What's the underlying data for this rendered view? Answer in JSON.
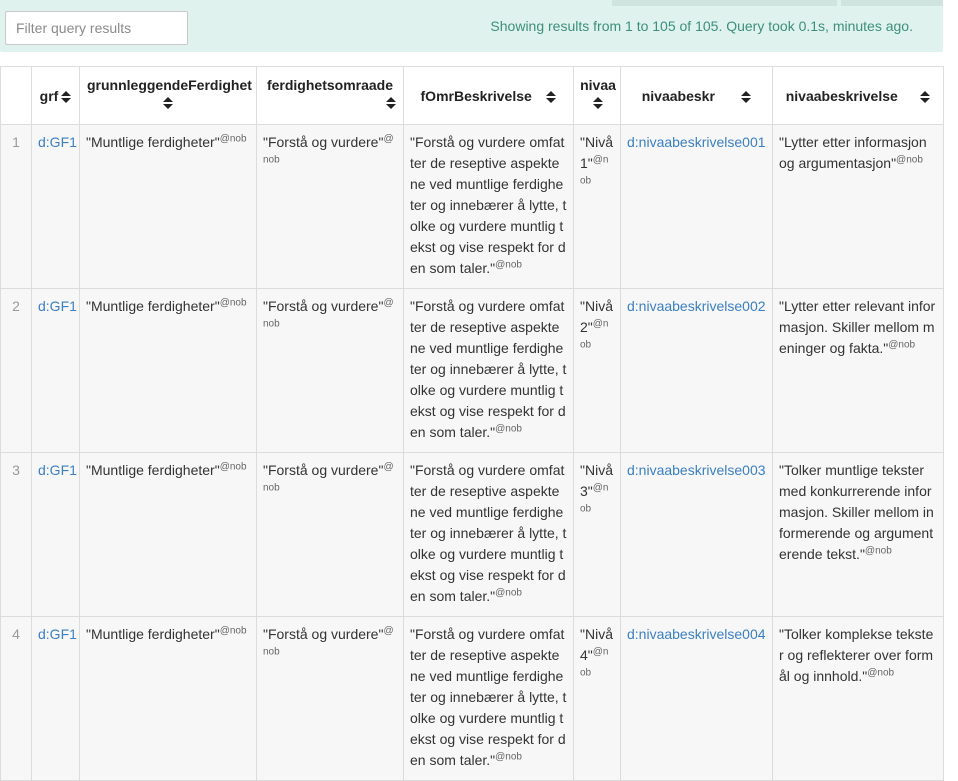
{
  "filter": {
    "placeholder": "Filter query results"
  },
  "status_text": "Showing results from 1 to 105 of 105. Query took 0.1s, minutes ago.",
  "columns": [
    "grf",
    "grunnleggendeFerdighet",
    "ferdighetsomraade",
    "fOmrBeskrivelse",
    "nivaa",
    "nivaabeskr",
    "nivaabeskrivelse"
  ],
  "rows": [
    {
      "num": "1",
      "grf": "d:GF1",
      "ferdighet": "\"Muntlige ferdigheter\"",
      "ferdighet_lang": "@nob",
      "omraade": "\"Forstå og vurdere\"",
      "omraade_lang": "@nob",
      "beskrivelse": "\"Forstå og vurdere omfatter de reseptive aspektene ved muntlige ferdigheter og innebærer å lytte, tolke og vurdere muntlig tekst og vise respekt for den som taler.\"",
      "beskrivelse_lang": "@nob",
      "nivaa": "\"Nivå 1\"",
      "nivaa_lang": "@nob",
      "nivaabeskr": "d:nivaabeskrivelse001",
      "nivaabeskrivelse": "\"Lytter etter informasjon og argumentasjon\"",
      "nivaabeskrivelse_lang": "@nob"
    },
    {
      "num": "2",
      "grf": "d:GF1",
      "ferdighet": "\"Muntlige ferdigheter\"",
      "ferdighet_lang": "@nob",
      "omraade": "\"Forstå og vurdere\"",
      "omraade_lang": "@nob",
      "beskrivelse": "\"Forstå og vurdere omfatter de reseptive aspektene ved muntlige ferdigheter og innebærer å lytte, tolke og vurdere muntlig tekst og vise respekt for den som taler.\"",
      "beskrivelse_lang": "@nob",
      "nivaa": "\"Nivå 2\"",
      "nivaa_lang": "@nob",
      "nivaabeskr": "d:nivaabeskrivelse002",
      "nivaabeskrivelse": "\"Lytter etter relevant informasjon. Skiller mellom meninger og fakta.\"",
      "nivaabeskrivelse_lang": "@nob"
    },
    {
      "num": "3",
      "grf": "d:GF1",
      "ferdighet": "\"Muntlige ferdigheter\"",
      "ferdighet_lang": "@nob",
      "omraade": "\"Forstå og vurdere\"",
      "omraade_lang": "@nob",
      "beskrivelse": "\"Forstå og vurdere omfatter de reseptive aspektene ved muntlige ferdigheter og innebærer å lytte, tolke og vurdere muntlig tekst og vise respekt for den som taler.\"",
      "beskrivelse_lang": "@nob",
      "nivaa": "\"Nivå 3\"",
      "nivaa_lang": "@nob",
      "nivaabeskr": "d:nivaabeskrivelse003",
      "nivaabeskrivelse": "\"Tolker muntlige tekster med konkurrerende informasjon. Skiller mellom informerende og argumenterende tekst.\"",
      "nivaabeskrivelse_lang": "@nob"
    },
    {
      "num": "4",
      "grf": "d:GF1",
      "ferdighet": "\"Muntlige ferdigheter\"",
      "ferdighet_lang": "@nob",
      "omraade": "\"Forstå og vurdere\"",
      "omraade_lang": "@nob",
      "beskrivelse": "\"Forstå og vurdere omfatter de reseptive aspektene ved muntlige ferdigheter og innebærer å lytte, tolke og vurdere muntlig tekst og vise respekt for den som taler.\"",
      "beskrivelse_lang": "@nob",
      "nivaa": "\"Nivå 4\"",
      "nivaa_lang": "@nob",
      "nivaabeskr": "d:nivaabeskrivelse004",
      "nivaabeskrivelse": "\"Tolker komplekse tekster og reflekterer over formål og innhold.\"",
      "nivaabeskrivelse_lang": "@nob"
    }
  ]
}
